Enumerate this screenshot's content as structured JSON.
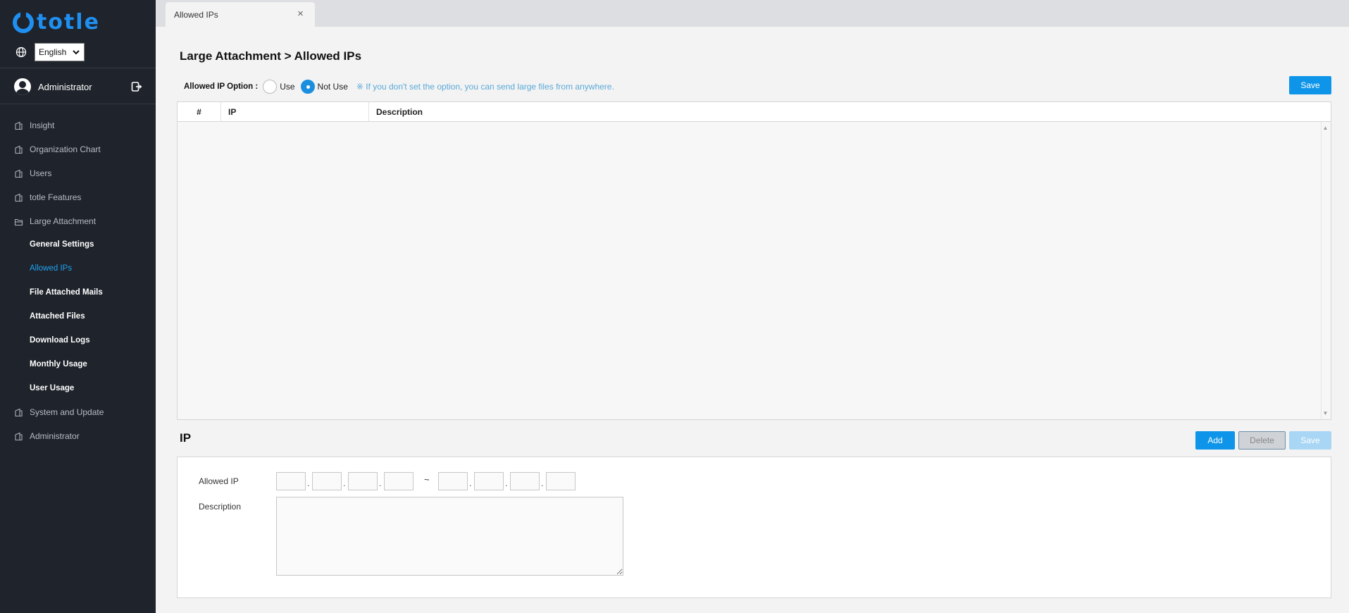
{
  "brand": {
    "name": "totle",
    "accent": "#1f8ff0"
  },
  "language": {
    "selected": "English",
    "icon": "globe-icon"
  },
  "user": {
    "name": "Administrator",
    "logout_icon": "logout-icon"
  },
  "nav": {
    "items": [
      {
        "label": "Insight"
      },
      {
        "label": "Organization Chart"
      },
      {
        "label": "Users"
      },
      {
        "label": "totle Features"
      },
      {
        "label": "Large Attachment"
      },
      {
        "label": "System and Update"
      },
      {
        "label": "Administrator"
      }
    ],
    "sub_items": [
      {
        "label": "General Settings"
      },
      {
        "label": "Allowed IPs"
      },
      {
        "label": "File Attached Mails"
      },
      {
        "label": "Attached Files"
      },
      {
        "label": "Download Logs"
      },
      {
        "label": "Monthly Usage"
      },
      {
        "label": "User Usage"
      }
    ]
  },
  "tab": {
    "label": "Allowed IPs",
    "close": "×"
  },
  "page": {
    "title": "Large Attachment > Allowed IPs",
    "option_label": "Allowed IP Option :",
    "option_use": "Use",
    "option_not_use": "Not Use",
    "option_selected": "Not Use",
    "option_note": "※ If you don't set the option, you can send large files from anywhere.",
    "save_label": "Save"
  },
  "grid": {
    "columns": [
      "#",
      "IP",
      "Description"
    ],
    "rows": []
  },
  "ip_section": {
    "title": "IP",
    "add_label": "Add",
    "delete_label": "Delete",
    "save_label": "Save",
    "allowed_ip_label": "Allowed IP",
    "range_separator": "~",
    "octet_separator": ".",
    "description_label": "Description"
  }
}
